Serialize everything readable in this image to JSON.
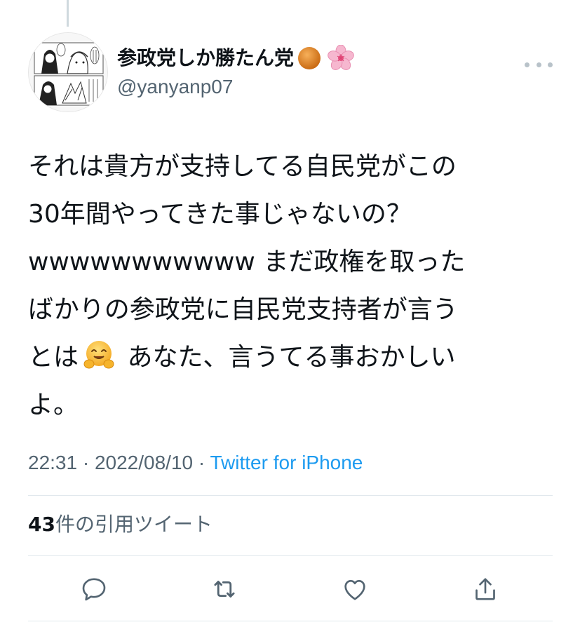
{
  "tweet": {
    "author": {
      "display_name": "参政党しか勝たん党",
      "name_emojis": [
        "orange-circle-emoji",
        "cherry-blossom-emoji"
      ],
      "username": "@yanyanp07"
    },
    "text_lines": [
      "それは貴方が支持してる自民党がこの",
      "30年間やってきた事じゃないの？",
      "wwwwwwwwwww まだ政権を取った",
      "ばかりの参政党に自民党支持者が言う"
    ],
    "text_line5_before": "とは",
    "text_line5_after": " あなた、言うてる事おかしい",
    "text_line6": "よ。",
    "text_emoji": "hugging-face-emoji",
    "time": "22:31",
    "date": "2022/08/10",
    "separator": "·",
    "source": "Twitter for iPhone"
  },
  "stats": {
    "quote_count": "43",
    "quote_label": "件の引用ツイート"
  },
  "actions": {
    "reply_icon": "reply-icon",
    "retweet_icon": "retweet-icon",
    "like_icon": "like-icon",
    "share_icon": "share-icon"
  },
  "colors": {
    "text": "#0f1419",
    "secondary": "#536471",
    "link": "#1d9bf0",
    "divider": "#e1e8ed"
  }
}
